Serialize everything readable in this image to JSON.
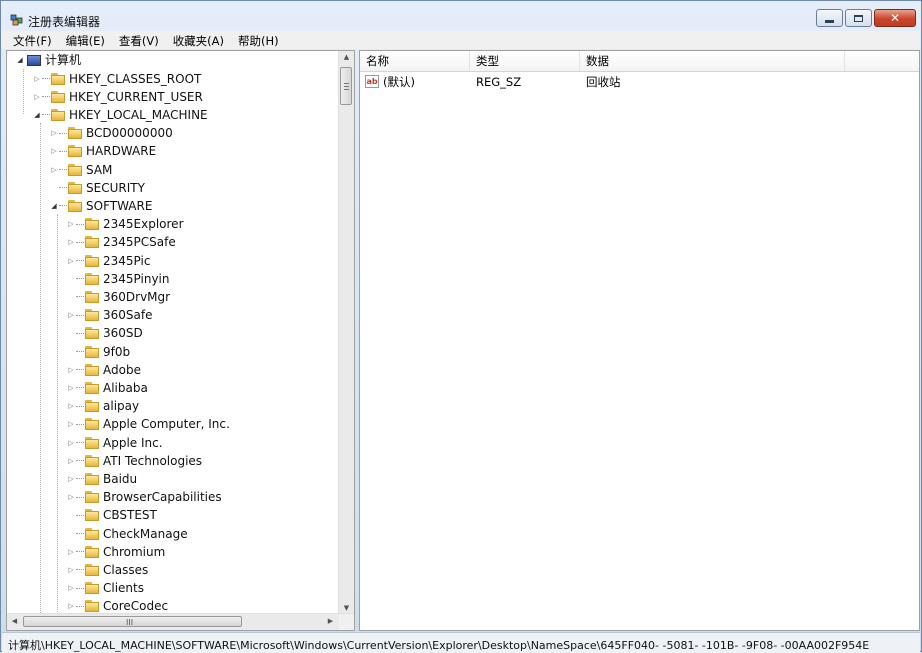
{
  "window": {
    "title": "注册表编辑器"
  },
  "menu": [
    "文件(F)",
    "编辑(E)",
    "查看(V)",
    "收藏夹(A)",
    "帮助(H)"
  ],
  "tree": {
    "root": "计算机",
    "items": [
      {
        "label": "HKEY_CLASSES_ROOT",
        "level": 1,
        "exp": "closed"
      },
      {
        "label": "HKEY_CURRENT_USER",
        "level": 1,
        "exp": "closed"
      },
      {
        "label": "HKEY_LOCAL_MACHINE",
        "level": 1,
        "exp": "open"
      },
      {
        "label": "BCD00000000",
        "level": 2,
        "exp": "closed"
      },
      {
        "label": "HARDWARE",
        "level": 2,
        "exp": "closed"
      },
      {
        "label": "SAM",
        "level": 2,
        "exp": "closed"
      },
      {
        "label": "SECURITY",
        "level": 2,
        "exp": "none"
      },
      {
        "label": "SOFTWARE",
        "level": 2,
        "exp": "open"
      },
      {
        "label": "2345Explorer",
        "level": 3,
        "exp": "closed"
      },
      {
        "label": "2345PCSafe",
        "level": 3,
        "exp": "closed"
      },
      {
        "label": "2345Pic",
        "level": 3,
        "exp": "closed"
      },
      {
        "label": "2345Pinyin",
        "level": 3,
        "exp": "none"
      },
      {
        "label": "360DrvMgr",
        "level": 3,
        "exp": "none"
      },
      {
        "label": "360Safe",
        "level": 3,
        "exp": "closed"
      },
      {
        "label": "360SD",
        "level": 3,
        "exp": "none"
      },
      {
        "label": "9f0b",
        "level": 3,
        "exp": "none"
      },
      {
        "label": "Adobe",
        "level": 3,
        "exp": "closed"
      },
      {
        "label": "Alibaba",
        "level": 3,
        "exp": "closed"
      },
      {
        "label": "alipay",
        "level": 3,
        "exp": "closed"
      },
      {
        "label": "Apple Computer, Inc.",
        "level": 3,
        "exp": "closed"
      },
      {
        "label": "Apple Inc.",
        "level": 3,
        "exp": "closed"
      },
      {
        "label": "ATI Technologies",
        "level": 3,
        "exp": "closed"
      },
      {
        "label": "Baidu",
        "level": 3,
        "exp": "closed"
      },
      {
        "label": "BrowserCapabilities",
        "level": 3,
        "exp": "closed"
      },
      {
        "label": "CBSTEST",
        "level": 3,
        "exp": "none"
      },
      {
        "label": "CheckManage",
        "level": 3,
        "exp": "none"
      },
      {
        "label": "Chromium",
        "level": 3,
        "exp": "closed"
      },
      {
        "label": "Classes",
        "level": 3,
        "exp": "closed"
      },
      {
        "label": "Clients",
        "level": 3,
        "exp": "closed"
      },
      {
        "label": "CoreCodec",
        "level": 3,
        "exp": "closed"
      }
    ]
  },
  "hscroll_grip": "III",
  "list": {
    "columns": [
      "名称",
      "类型",
      "数据"
    ],
    "rows": [
      {
        "icon": "ab",
        "name": "(默认)",
        "type": "REG_SZ",
        "data": "回收站"
      }
    ]
  },
  "status": {
    "path": "计算机\\HKEY_LOCAL_MACHINE\\SOFTWARE\\Microsoft\\Windows\\CurrentVersion\\Explorer\\Desktop\\NameSpace\\645FF040- -5081- -101B- -9F08- -00AA002F954E"
  }
}
